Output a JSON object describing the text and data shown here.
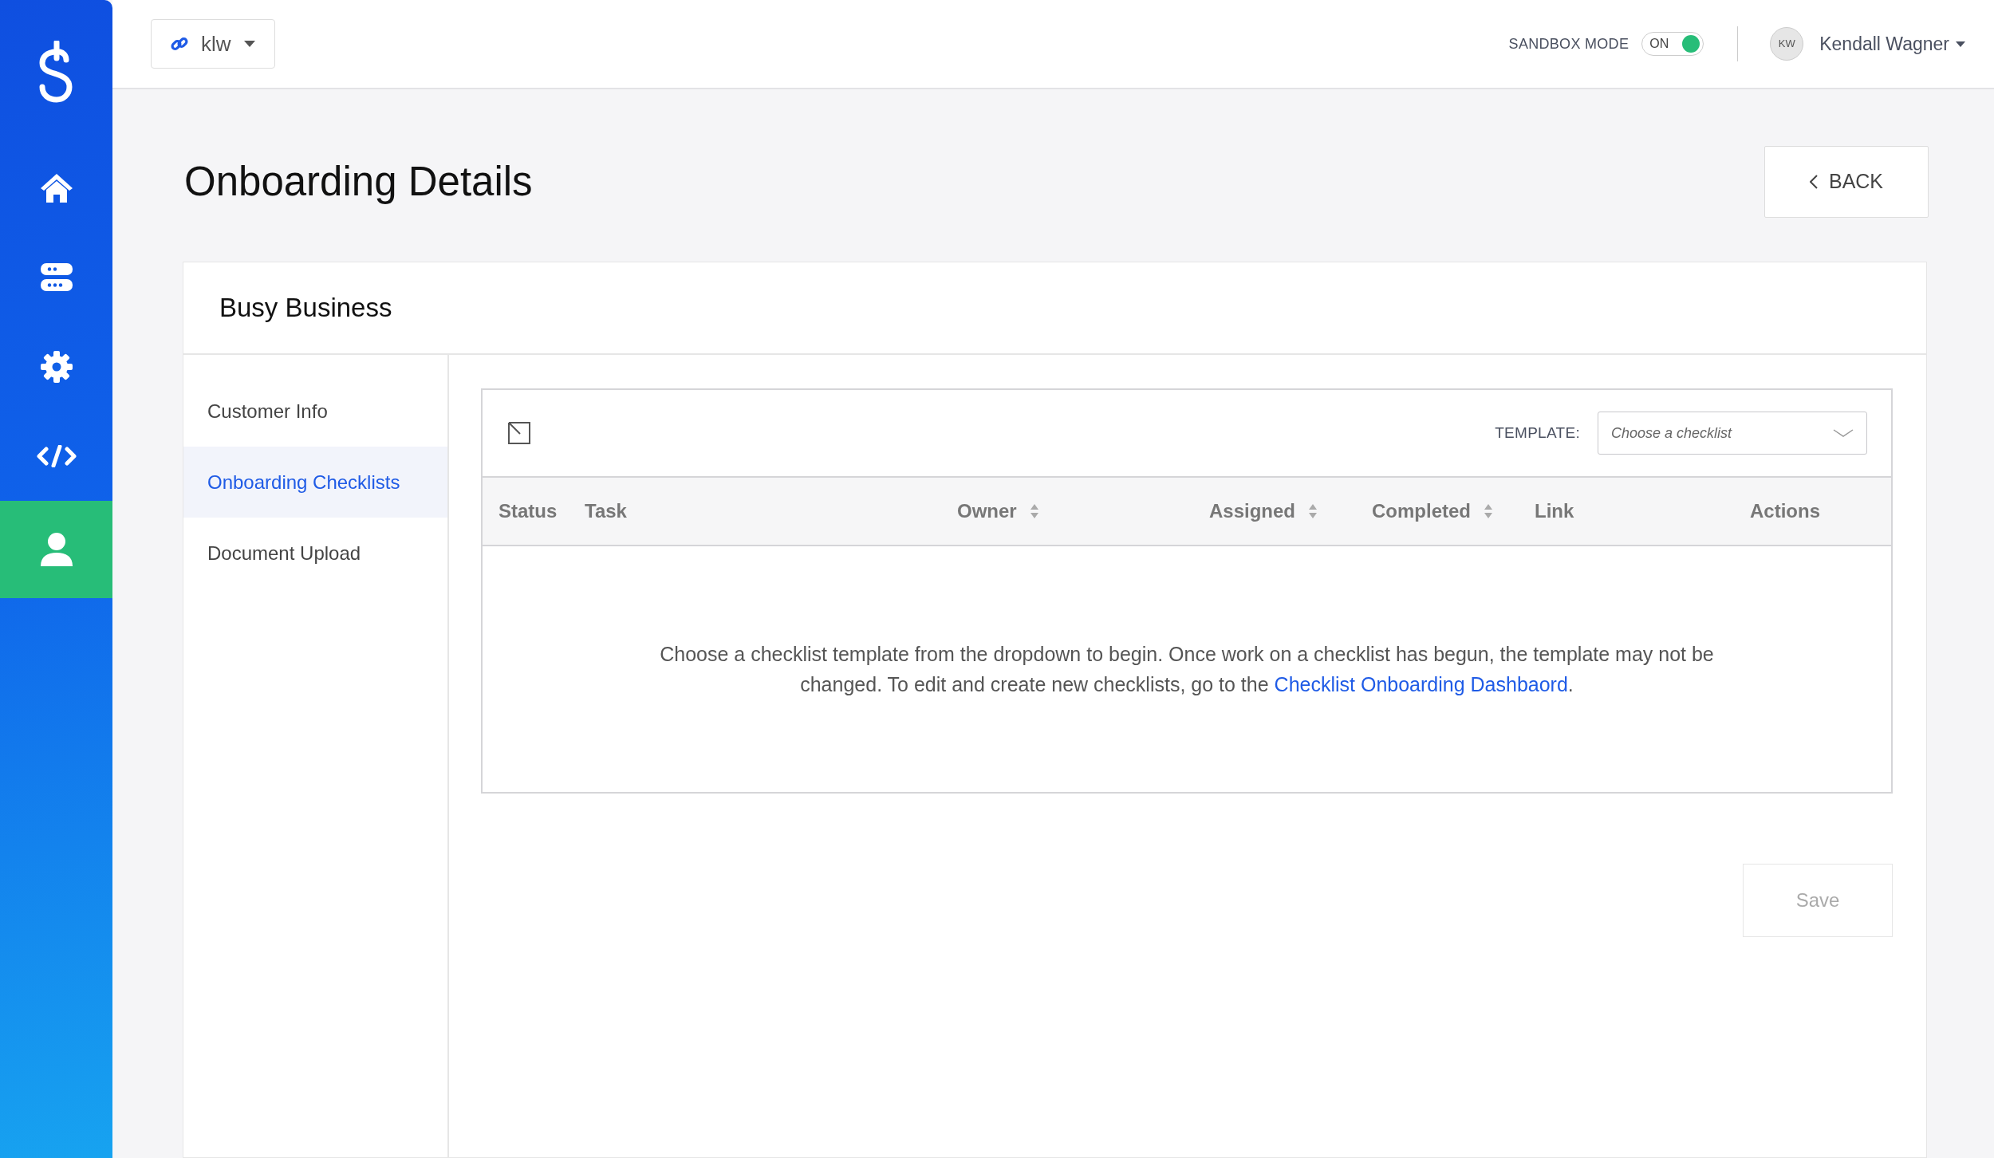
{
  "sidebar": {
    "items": [
      {
        "kind": "home",
        "selected": false
      },
      {
        "kind": "servers",
        "selected": false
      },
      {
        "kind": "settings",
        "selected": false
      },
      {
        "kind": "code",
        "selected": false
      },
      {
        "kind": "user",
        "selected": true
      }
    ]
  },
  "topbar": {
    "account_selector": {
      "value": "klw"
    },
    "sandbox_mode": {
      "label": "SANDBOX MODE",
      "toggle_text": "ON",
      "on": true
    },
    "user": {
      "initials": "KW",
      "name": "Kendall Wagner"
    }
  },
  "page": {
    "title": "Onboarding Details",
    "back_button": "BACK"
  },
  "card": {
    "title": "Busy Business",
    "tabs": [
      {
        "label": "Customer Info",
        "selected": false
      },
      {
        "label": "Onboarding Checklists",
        "selected": true
      },
      {
        "label": "Document Upload",
        "selected": false
      }
    ],
    "checklist": {
      "template_label": "TEMPLATE:",
      "template_select": {
        "placeholder": "Choose a checklist"
      },
      "columns": [
        {
          "label": "Status",
          "sortable": false
        },
        {
          "label": "Task",
          "sortable": false
        },
        {
          "label": "Owner",
          "sortable": true
        },
        {
          "label": "Assigned",
          "sortable": true
        },
        {
          "label": "Completed",
          "sortable": true
        },
        {
          "label": "Link",
          "sortable": false
        },
        {
          "label": "Actions",
          "sortable": false
        }
      ],
      "empty_message": {
        "text": "Choose a checklist template from the dropdown to begin. Once work on a checklist has begun, the template may not be changed. To edit and create new checklists, go to the",
        "link": "Checklist Onboarding Dashbaord",
        "after": "."
      }
    },
    "save_button": {
      "label": "Save",
      "disabled": true
    }
  }
}
